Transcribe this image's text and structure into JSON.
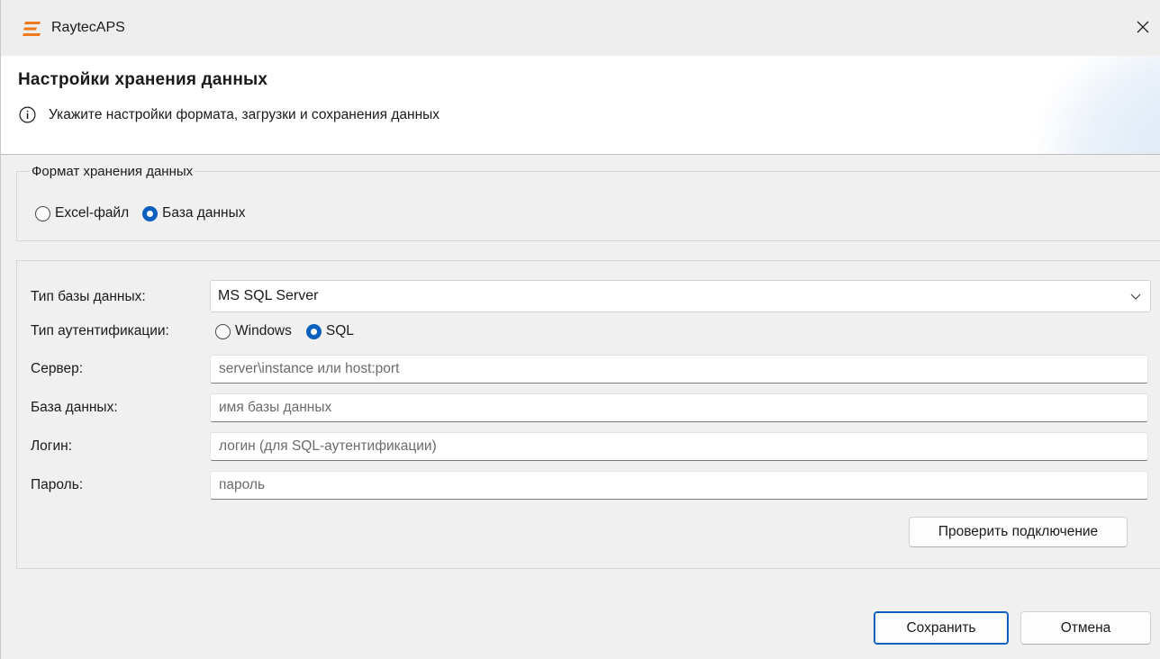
{
  "window": {
    "title": "RaytecAPS"
  },
  "header": {
    "title": "Настройки хранения данных",
    "subtitle": "Укажите настройки формата, загрузки и сохранения данных"
  },
  "format_group": {
    "legend": "Формат хранения данных",
    "options": [
      {
        "label": "Excel-файл",
        "checked": false
      },
      {
        "label": "База данных",
        "checked": true
      }
    ]
  },
  "db_settings": {
    "db_type": {
      "label": "Тип базы данных:",
      "value": "MS SQL Server"
    },
    "auth": {
      "label": "Тип аутентификации:",
      "options": [
        {
          "label": "Windows",
          "checked": false
        },
        {
          "label": "SQL",
          "checked": true
        }
      ]
    },
    "server": {
      "label": "Сервер:",
      "value": "",
      "placeholder": "server\\instance или host:port"
    },
    "database": {
      "label": "База данных:",
      "value": "",
      "placeholder": "имя базы данных"
    },
    "login": {
      "label": "Логин:",
      "value": "",
      "placeholder": "логин (для SQL-аутентификации)"
    },
    "password": {
      "label": "Пароль:",
      "value": "",
      "placeholder": "пароль"
    },
    "test_button": "Проверить подключение"
  },
  "footer": {
    "save_button": "Сохранить",
    "cancel_button": "Отмена"
  },
  "colors": {
    "accent": "#0a5fbf",
    "logo": "#f07a1a"
  }
}
